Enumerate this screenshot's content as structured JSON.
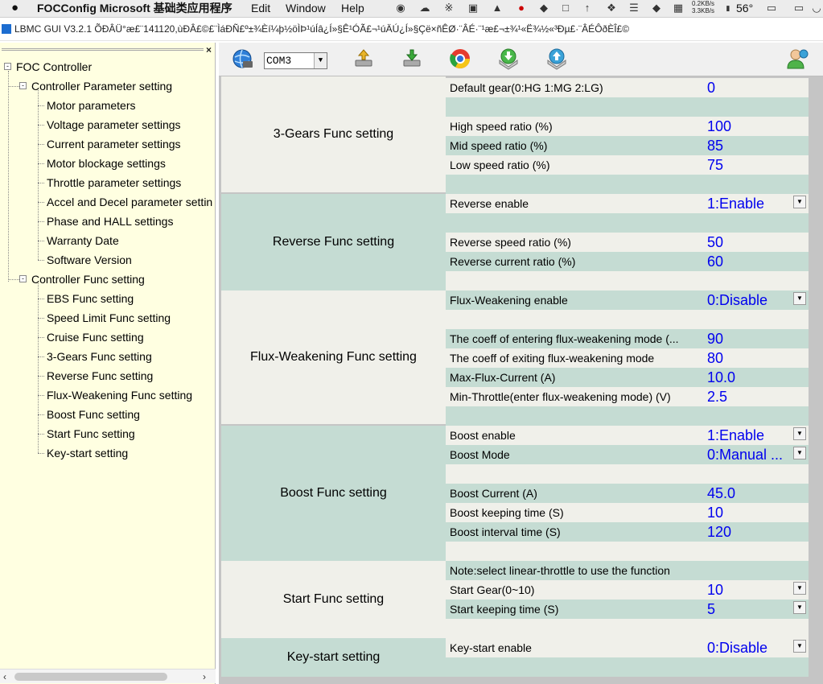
{
  "menubar": {
    "app_name": "FOCConfig Microsoft 基础类应用程序",
    "menus": [
      "Edit",
      "Window",
      "Help"
    ],
    "net_up": "0.2KB/s",
    "net_down": "3.3KB/s",
    "temperature": "56°"
  },
  "title": {
    "text": "LBMC GUI V3.2.1 ÕÐÂÜ°æ£¨141120,ùÐÂ£©£¨ÌáÐÑ£º±¾Èí¼þ½öÌÞ¹úÍâ¿Í»§Ê¹ÓÃ£¬¹úÄÚ¿Í»§Çë×ñÊØ·¨ÂÉ·¨¹æ£¬±¾¹«Ë¾½«³Ðµ£·¨ÂÉÔðÈÎ£©"
  },
  "tree": {
    "root": "FOC Controller",
    "group1": {
      "label": "Controller Parameter setting",
      "items": [
        "Motor parameters",
        "Voltage parameter settings",
        "Current parameter settings",
        "Motor blockage settings",
        "Throttle parameter settings",
        "Accel and Decel parameter settin",
        "Phase and HALL settings",
        "Warranty Date",
        "Software Version"
      ]
    },
    "group2": {
      "label": "Controller Func setting",
      "items": [
        "EBS Func setting",
        "Speed Limit Func setting",
        "Cruise Func setting",
        "3-Gears Func setting",
        "Reverse Func setting",
        "Flux-Weakening Func setting",
        "Boost Func setting",
        "Start Func setting",
        "Key-start setting"
      ]
    }
  },
  "toolbar": {
    "com_port": "COM3"
  },
  "sections": [
    {
      "title": "3-Gears Func setting",
      "rows": [
        {
          "label": "Default gear(0:HG 1:MG 2:LG)",
          "value": "0"
        },
        {
          "label": "",
          "value": ""
        },
        {
          "label": "High speed ratio (%)",
          "value": "100"
        },
        {
          "label": "Mid speed ratio (%)",
          "value": "85"
        },
        {
          "label": "Low speed ratio (%)",
          "value": "75"
        },
        {
          "label": "",
          "value": ""
        }
      ]
    },
    {
      "title": "Reverse Func setting",
      "rows": [
        {
          "label": "Reverse enable",
          "value": "1:Enable"
        },
        {
          "label": "",
          "value": ""
        },
        {
          "label": "Reverse speed ratio (%)",
          "value": "50"
        },
        {
          "label": "Reverse current ratio (%)",
          "value": "60"
        },
        {
          "label": "",
          "value": ""
        }
      ]
    },
    {
      "title": "Flux-Weakening Func setting",
      "rows": [
        {
          "label": "Flux-Weakening enable",
          "value": "0:Disable"
        },
        {
          "label": "",
          "value": ""
        },
        {
          "label": "The coeff of entering flux-weakening mode (...",
          "value": "90"
        },
        {
          "label": "The coeff of exiting flux-weakening mode",
          "value": "80"
        },
        {
          "label": "Max-Flux-Current (A)",
          "value": "10.0"
        },
        {
          "label": "Min-Throttle(enter flux-weakening mode) (V)",
          "value": "2.5"
        },
        {
          "label": "",
          "value": ""
        }
      ]
    },
    {
      "title": "Boost Func setting",
      "rows": [
        {
          "label": "Boost enable",
          "value": "1:Enable"
        },
        {
          "label": "Boost Mode",
          "value": "0:Manual ..."
        },
        {
          "label": "",
          "value": ""
        },
        {
          "label": "Boost Current (A)",
          "value": "45.0"
        },
        {
          "label": "Boost keeping time (S)",
          "value": "10"
        },
        {
          "label": "Boost interval time (S)",
          "value": "120"
        },
        {
          "label": "",
          "value": ""
        }
      ]
    },
    {
      "title": "Start Func setting",
      "rows": [
        {
          "label": "Note:select linear-throttle to use the function",
          "value": ""
        },
        {
          "label": "Start Gear(0~10)",
          "value": "10"
        },
        {
          "label": "Start keeping time (S)",
          "value": "5"
        },
        {
          "label": "",
          "value": ""
        }
      ]
    },
    {
      "title": "Key-start setting",
      "rows": [
        {
          "label": "Key-start enable",
          "value": "0:Disable"
        },
        {
          "label": "",
          "value": ""
        }
      ]
    }
  ]
}
